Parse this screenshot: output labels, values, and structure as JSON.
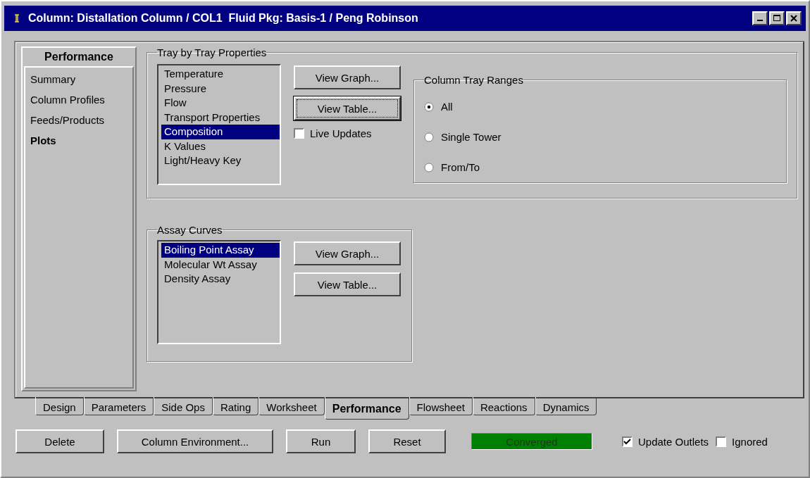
{
  "window": {
    "title": "Column: Distallation Column / COL1  Fluid Pkg: Basis-1 / Peng Robinson"
  },
  "nav": {
    "header": "Performance",
    "items": [
      {
        "label": "Summary",
        "selected": false
      },
      {
        "label": "Column Profiles",
        "selected": false
      },
      {
        "label": "Feeds/Products",
        "selected": false
      },
      {
        "label": "Plots",
        "selected": true
      }
    ]
  },
  "tray_group": {
    "title": "Tray by Tray Properties",
    "items": [
      {
        "label": "Temperature",
        "selected": false
      },
      {
        "label": "Pressure",
        "selected": false
      },
      {
        "label": "Flow",
        "selected": false
      },
      {
        "label": "Transport Properties",
        "selected": false
      },
      {
        "label": "Composition",
        "selected": true
      },
      {
        "label": "K Values",
        "selected": false
      },
      {
        "label": "Light/Heavy Key",
        "selected": false
      }
    ],
    "buttons": [
      {
        "label": "View Graph...",
        "focused": false
      },
      {
        "label": "View Table...",
        "focused": true
      }
    ],
    "live_updates": {
      "label": "Live Updates",
      "checked": false
    }
  },
  "ranges": {
    "title": "Column Tray Ranges",
    "options": [
      {
        "label": "All",
        "selected": true
      },
      {
        "label": "Single Tower",
        "selected": false
      },
      {
        "label": "From/To",
        "selected": false
      }
    ]
  },
  "assay": {
    "title": "Assay Curves",
    "items": [
      {
        "label": "Boiling Point Assay",
        "selected": true
      },
      {
        "label": "Molecular Wt Assay",
        "selected": false
      },
      {
        "label": "Density Assay",
        "selected": false
      }
    ],
    "buttons": [
      {
        "label": "View Graph...",
        "focused": false
      },
      {
        "label": "View Table...",
        "focused": false
      }
    ]
  },
  "tabs": [
    {
      "label": "Design",
      "selected": false
    },
    {
      "label": "Parameters",
      "selected": false
    },
    {
      "label": "Side Ops",
      "selected": false
    },
    {
      "label": "Rating",
      "selected": false
    },
    {
      "label": "Worksheet",
      "selected": false
    },
    {
      "label": "Performance",
      "selected": true
    },
    {
      "label": "Flowsheet",
      "selected": false
    },
    {
      "label": "Reactions",
      "selected": false
    },
    {
      "label": "Dynamics",
      "selected": false
    }
  ],
  "actions": [
    "Delete",
    "Column Environment...",
    "Run",
    "Reset"
  ],
  "status": {
    "text": "Converged",
    "color": "#008000"
  },
  "checks": [
    {
      "label": "Update Outlets",
      "checked": true
    },
    {
      "label": "Ignored",
      "checked": false
    }
  ]
}
